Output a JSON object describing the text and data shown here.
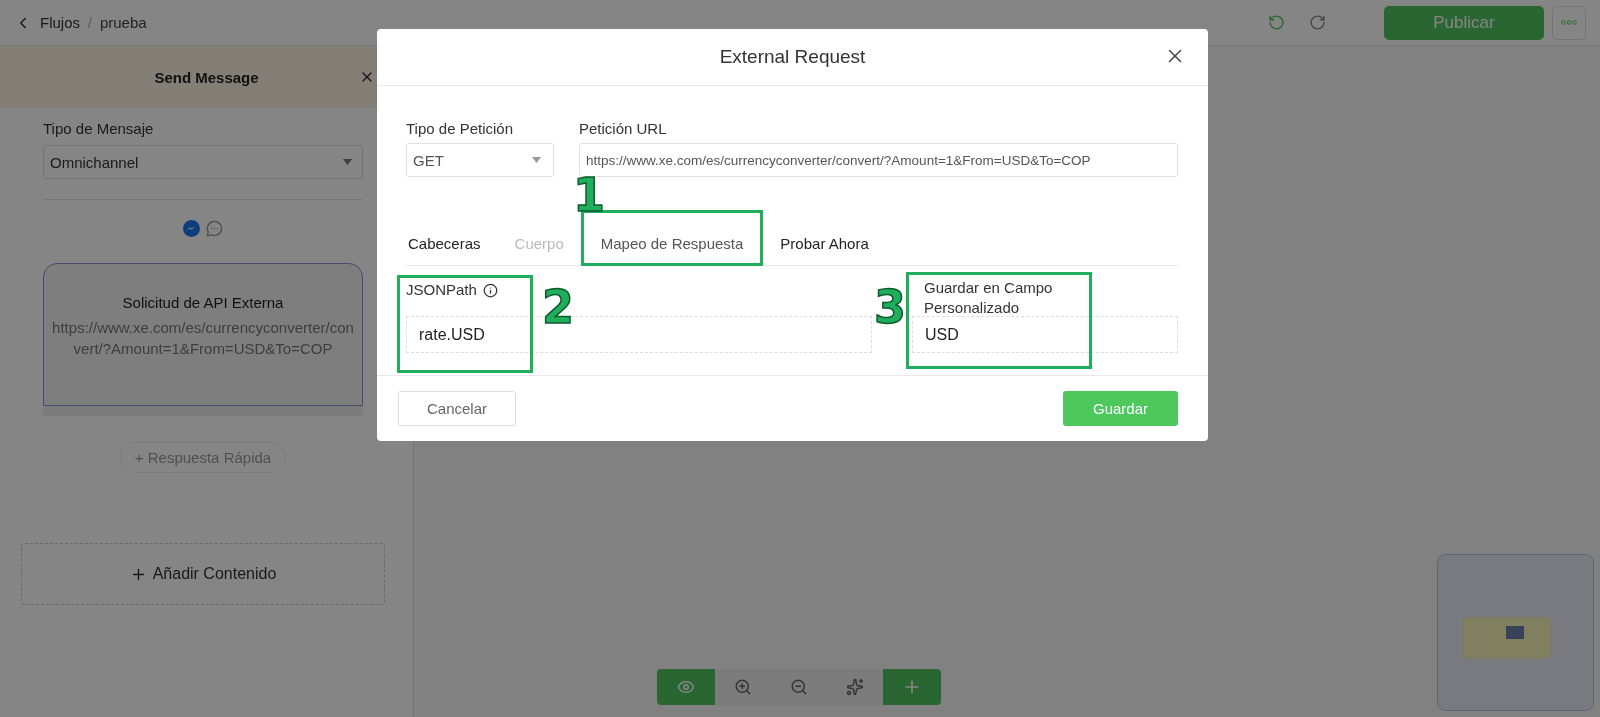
{
  "topbar": {
    "breadcrumb": [
      "Flujos",
      "prueba"
    ],
    "breadcrumb_separator": "/",
    "publish_button": "Publicar"
  },
  "panel": {
    "title": "Send Message",
    "message_type_label": "Tipo de Mensaje",
    "message_type_value": "Omnichannel",
    "card": {
      "title": "Solicitud de API Externa",
      "url": "https://www.xe.com/es/currencyconverter/convert/?Amount=1&From=USD&To=COP"
    },
    "quick_reply_button": "+ Respuesta Rápida",
    "add_content_button": "Añadir Contenido"
  },
  "canvas_tools": [
    {
      "kind": "preview",
      "active": true
    },
    {
      "kind": "zoom_in",
      "active": false
    },
    {
      "kind": "zoom_out",
      "active": false
    },
    {
      "kind": "magic",
      "active": false
    },
    {
      "kind": "add",
      "active": true
    }
  ],
  "modal": {
    "title": "External Request",
    "request_type_label": "Tipo de Petición",
    "request_type_value": "GET",
    "url_label": "Petición URL",
    "url_value": "https://www.xe.com/es/currencyconverter/convert/?Amount=1&From=USD&To=COP",
    "tabs": [
      {
        "label": "Cabeceras",
        "selected": false,
        "disabled": false
      },
      {
        "label": "Cuerpo",
        "selected": false,
        "disabled": true
      },
      {
        "label": "Mapeo de Respuesta",
        "selected": true,
        "disabled": false
      },
      {
        "label": "Probar Ahora",
        "selected": false,
        "disabled": false
      }
    ],
    "mapping": {
      "jsonpath_label": "JSONPath",
      "jsonpath_value": "rate.USD",
      "field_label": "Guardar en Campo Personalizado",
      "field_value": "USD"
    },
    "cancel_button": "Cancelar",
    "save_button": "Guardar"
  },
  "annotations": [
    "1",
    "2",
    "3"
  ]
}
